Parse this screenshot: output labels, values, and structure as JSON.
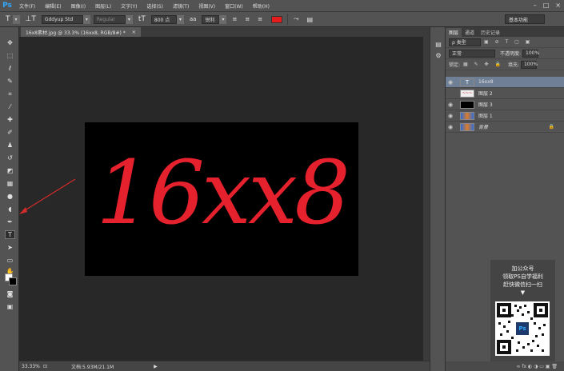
{
  "app": {
    "logo": "Ps"
  },
  "menu": [
    "文件(F)",
    "编辑(E)",
    "图像(I)",
    "图层(L)",
    "文字(Y)",
    "选择(S)",
    "滤镜(T)",
    "视图(V)",
    "窗口(W)",
    "帮助(H)"
  ],
  "window_controls": [
    "–",
    "□",
    "×"
  ],
  "options": {
    "tool_glyph": "T",
    "orient_glyph": "⊥T",
    "font_family": "Gddyup Std",
    "font_style": "Regular",
    "size_glyph": "tT",
    "font_size": "800 点",
    "aa_glyph": "aa",
    "antialias": "锐利",
    "text_color": "#e51c1c",
    "workspace": "基本功能"
  },
  "document": {
    "tab_title": "16x8素材.jpg @ 33.3% (16xx8, RGB/8#) *",
    "tab_close": "×",
    "canvas_text": "16xx8",
    "canvas_text_color": "#e4212c"
  },
  "status": {
    "zoom": "33.33%",
    "doc_info": "文档:5.93M/21.1M",
    "arrow": "▶"
  },
  "layers_panel": {
    "tabs": [
      "图层",
      "通道",
      "历史记录"
    ],
    "filter": "ρ 类型",
    "filter_icons": "▣ ⊘ T ▢ ▣",
    "blend_mode": "正常",
    "opacity_label": "不透明度:",
    "opacity": "100%",
    "lock_label": "锁定:",
    "lock_icons": "▦ ✎ ✥ 🔒",
    "fill_label": "填充:",
    "fill": "100%",
    "layers": [
      {
        "name": "16xx8",
        "thumb": "T",
        "visible": "◉",
        "selected": true,
        "lock": ""
      },
      {
        "name": "图层 2",
        "thumb": "",
        "visible": "",
        "selected": false,
        "lock": ""
      },
      {
        "name": "图层 3",
        "thumb": "",
        "visible": "◉",
        "selected": false,
        "lock": ""
      },
      {
        "name": "图层 1",
        "thumb": "",
        "visible": "◉",
        "selected": false,
        "lock": ""
      },
      {
        "name": "背景",
        "thumb": "",
        "visible": "◉",
        "selected": false,
        "lock": "🔒"
      }
    ],
    "footer_icons": "∞ fx ◐ ◑ ▭ ▣ 🗑"
  },
  "promo": {
    "line1": "加公众号",
    "line2": "领取PS自学福利",
    "line3": "赶快微信扫一扫",
    "arrow": "▼",
    "qr_logo": "Ps"
  }
}
